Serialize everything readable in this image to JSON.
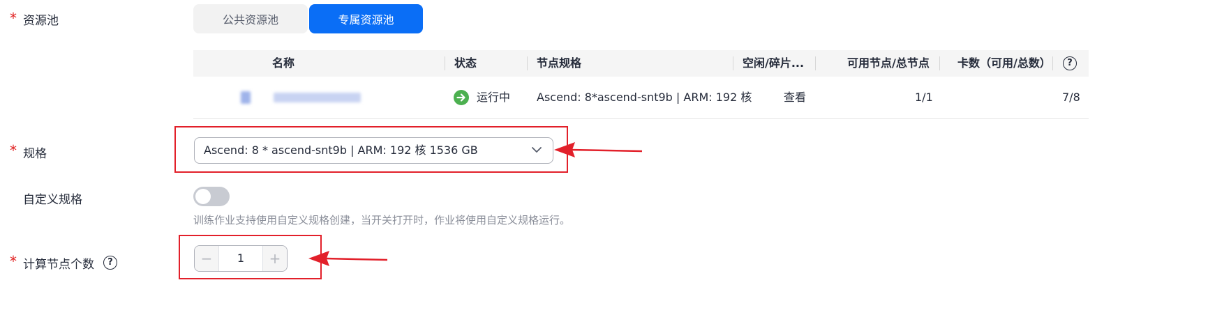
{
  "fields": {
    "resource_pool": {
      "required_mark": "*",
      "label": "资源池"
    },
    "spec": {
      "required_mark": "*",
      "label": "规格",
      "value": "Ascend: 8 * ascend-snt9b | ARM: 192 核 1536 GB"
    },
    "custom_spec": {
      "label": "自定义规格",
      "enabled": false,
      "hint": "训练作业支持使用自定义规格创建，当开关打开时，作业将使用自定义规格运行。"
    },
    "node_count": {
      "required_mark": "*",
      "label": "计算节点个数",
      "value": "1",
      "minus": "−",
      "plus": "+"
    }
  },
  "pool_tabs": [
    {
      "label": "公共资源池",
      "selected": false
    },
    {
      "label": "专属资源池",
      "selected": true
    }
  ],
  "table": {
    "columns": [
      "名称",
      "状态",
      "节点规格",
      "空闲/碎片...",
      "可用节点/总节点",
      "卡数（可用/总数）"
    ],
    "help": "?",
    "rows": [
      {
        "name": "",
        "status": "运行中",
        "node_spec": "Ascend: 8*ascend-snt9b | ARM: 192 核",
        "idle": "查看",
        "nodes": "1/1",
        "cards": "7/8"
      }
    ]
  },
  "help_icon": "?",
  "colors": {
    "primary": "#0a6ef6",
    "required": "#e02020",
    "status_running": "#4cb050",
    "annotation": "#e2202a"
  },
  "icons": {
    "status": "arrow-right-circle-icon",
    "select": "chevron-down-icon",
    "help": "question-circle-icon"
  }
}
